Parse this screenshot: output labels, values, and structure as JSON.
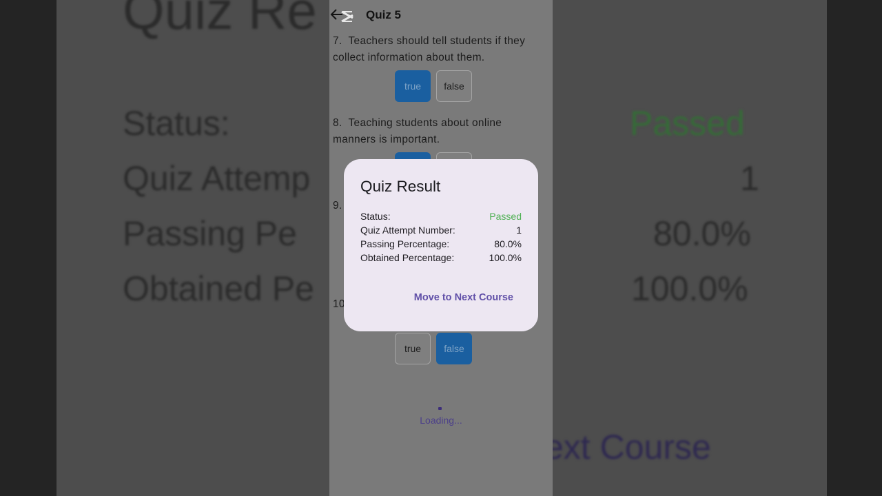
{
  "appbar": {
    "title": "Quiz 5"
  },
  "questions": [
    {
      "number": "7.",
      "text": "Teachers should tell students if they collect information about them.",
      "answers": [
        "true",
        "false"
      ],
      "selected": "true"
    },
    {
      "number": "8.",
      "text": "Teaching students about online manners is important.",
      "answers": [
        "true",
        "false"
      ],
      "selected": "true"
    },
    {
      "number": "9.",
      "text": "",
      "answers": [],
      "selected": ""
    },
    {
      "number": "10",
      "text": "",
      "answers": [
        "true",
        "false"
      ],
      "selected": "false"
    }
  ],
  "loading": {
    "text": "Loading..."
  },
  "dialog": {
    "title": "Quiz Result",
    "rows": [
      {
        "label": "Status:",
        "value": "Passed"
      },
      {
        "label": "Quiz Attempt Number:",
        "value": "1"
      },
      {
        "label": "Passing Percentage:",
        "value": "80.0%"
      },
      {
        "label": "Obtained Percentage:",
        "value": "100.0%"
      }
    ],
    "action": "Move to Next Course"
  },
  "colors": {
    "passed": "#4caf50",
    "accent": "#6150a8",
    "selected_answer": "#1a5fa0"
  }
}
